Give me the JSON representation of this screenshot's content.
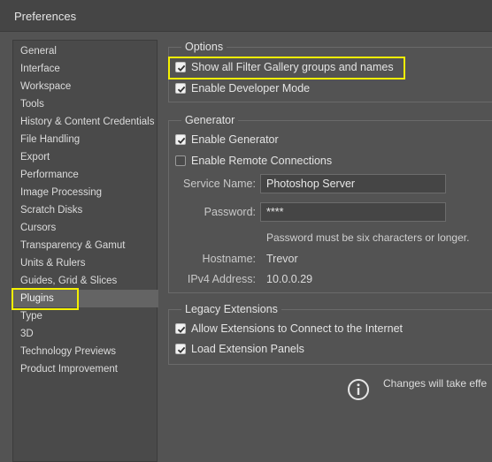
{
  "window": {
    "title": "Preferences"
  },
  "sidebar": {
    "items": [
      {
        "label": "General"
      },
      {
        "label": "Interface"
      },
      {
        "label": "Workspace"
      },
      {
        "label": "Tools"
      },
      {
        "label": "History & Content Credentials"
      },
      {
        "label": "File Handling"
      },
      {
        "label": "Export"
      },
      {
        "label": "Performance"
      },
      {
        "label": "Image Processing"
      },
      {
        "label": "Scratch Disks"
      },
      {
        "label": "Cursors"
      },
      {
        "label": "Transparency & Gamut"
      },
      {
        "label": "Units & Rulers"
      },
      {
        "label": "Guides, Grid & Slices"
      },
      {
        "label": "Plugins",
        "selected": true
      },
      {
        "label": "Type"
      },
      {
        "label": "3D"
      },
      {
        "label": "Technology Previews"
      },
      {
        "label": "Product Improvement"
      }
    ]
  },
  "options": {
    "legend": "Options",
    "show_filter_gallery": {
      "label": "Show all Filter Gallery groups and names",
      "checked": true
    },
    "developer_mode": {
      "label": "Enable Developer Mode",
      "checked": true
    }
  },
  "generator": {
    "legend": "Generator",
    "enable_generator": {
      "label": "Enable Generator",
      "checked": true
    },
    "remote_connections": {
      "label": "Enable Remote Connections",
      "checked": false
    },
    "service_name_label": "Service Name:",
    "service_name_value": "Photoshop Server",
    "password_label": "Password:",
    "password_value": "****",
    "password_note": "Password must be six characters or longer.",
    "hostname_label": "Hostname:",
    "hostname_value": "Trevor",
    "ipv4_label": "IPv4 Address:",
    "ipv4_value": "10.0.0.29"
  },
  "legacy": {
    "legend": "Legacy Extensions",
    "allow_internet": {
      "label": "Allow Extensions to Connect to the Internet",
      "checked": true
    },
    "load_panels": {
      "label": "Load Extension Panels",
      "checked": true
    }
  },
  "info": {
    "icon": "info-icon",
    "text": "Changes will take effe"
  },
  "colors": {
    "highlight": "#f4f000",
    "background": "#535353",
    "selected": "#646464"
  }
}
